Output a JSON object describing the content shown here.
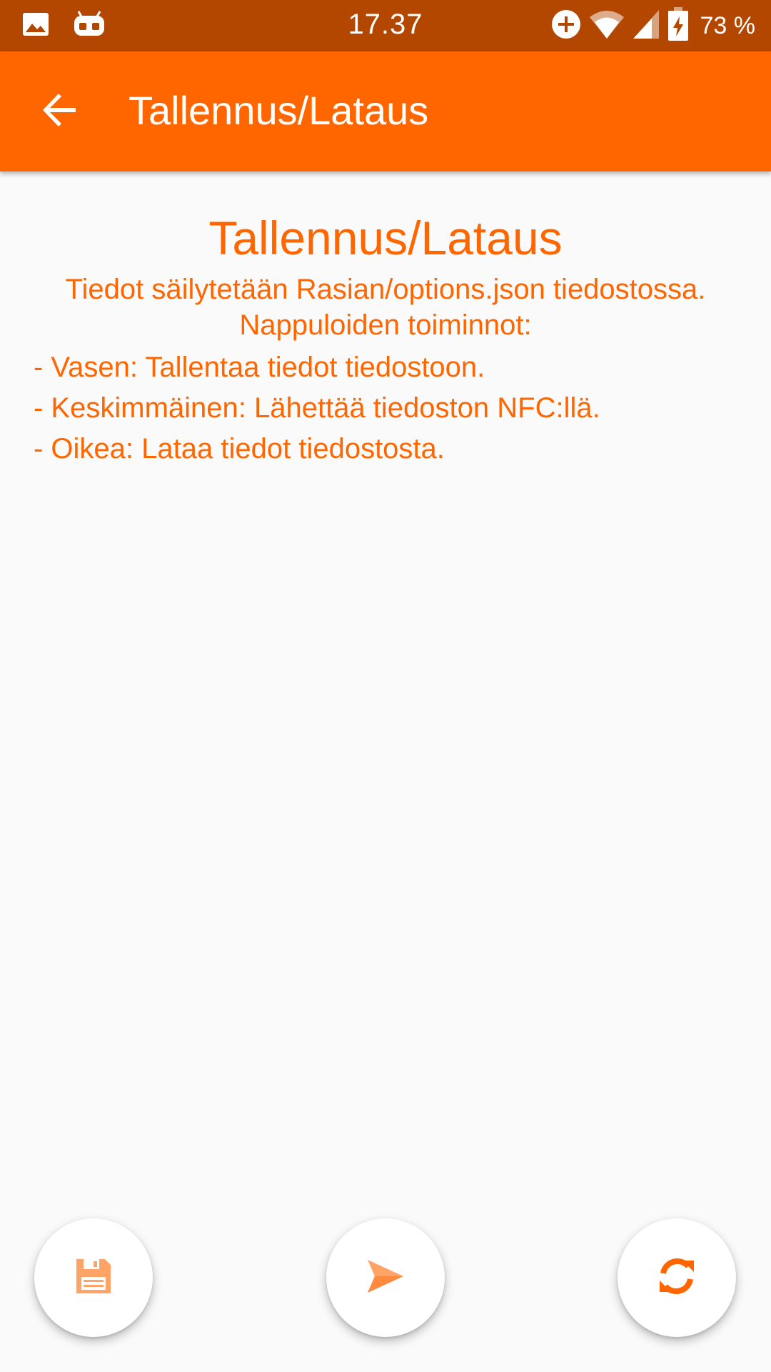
{
  "status_bar": {
    "time": "17.37",
    "battery_text": "73 %",
    "icons": [
      "image-icon",
      "android-debug-icon",
      "data-saver-icon",
      "wifi-icon",
      "cell-signal-icon",
      "battery-charging-icon"
    ]
  },
  "app_bar": {
    "title": "Tallennus/Lataus",
    "back_icon": "arrow-back-icon"
  },
  "content": {
    "title": "Tallennus/Lataus",
    "description_line1": "Tiedot säilytetään Rasian/options.json tiedostossa.",
    "description_line2": "Nappuloiden toiminnot:",
    "items": [
      "- Vasen: Tallentaa tiedot tiedostoon.",
      "- Keskimmäinen: Lähettää tiedoston NFC:llä.",
      "- Oikea: Lataa tiedot tiedostosta."
    ]
  },
  "buttons": {
    "left_icon": "save-icon",
    "center_icon": "send-icon",
    "right_icon": "refresh-icon"
  },
  "colors": {
    "status_bar": "#b34700",
    "accent": "#ff6600",
    "background": "#fafafa"
  }
}
